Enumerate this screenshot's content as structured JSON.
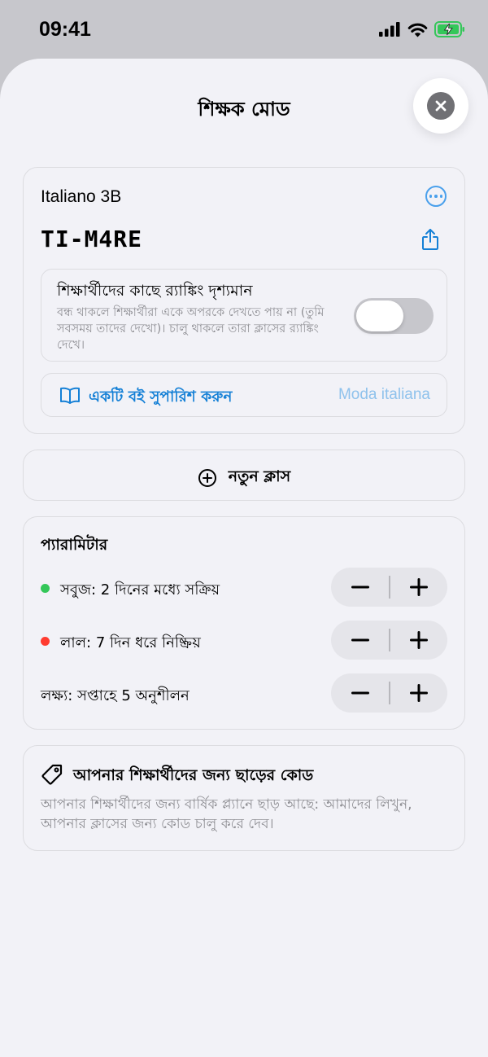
{
  "status_bar": {
    "time": "09:41"
  },
  "sheet": {
    "title": "শিক্ষক মোড"
  },
  "class_card": {
    "name": "Italiano 3B",
    "code": "TI-M4RE",
    "ranking": {
      "title": "শিক্ষার্থীদের কাছে র‍্যাঙ্কিং দৃশ্যমান",
      "description": "বন্ধ থাকলে শিক্ষার্থীরা একে অপরকে দেখতে পায় না (তুমি সবসময় তাদের দেখো)। চালু থাকলে তারা ক্লাসের র‍্যাঙ্কিং দেখে।",
      "enabled": false
    },
    "book": {
      "label": "একটি বই সুপারিশ করুন",
      "value": "Moda italiana"
    }
  },
  "new_class": {
    "label": "নতুন ক্লাস"
  },
  "params": {
    "title": "প্যারামিটার",
    "rows": [
      {
        "label": "সবুজ: 2 দিনের মধ্যে সক্রিয়",
        "dot_color": "#34c759"
      },
      {
        "label": "লাল: 7 দিন ধরে নিষ্ক্রিয়",
        "dot_color": "#ff3b30"
      },
      {
        "label": "লক্ষ্য: সপ্তাহে 5 অনুশীলন",
        "dot_color": ""
      }
    ]
  },
  "promo": {
    "title": "আপনার শিক্ষার্থীদের জন্য ছাড়ের কোড",
    "description": "আপনার শিক্ষার্থীদের জন্য বার্ষিক প্ল্যানে ছাড় আছে: আমাদের লিখুন, আপনার ক্লাসের জন্য কোড চালু করে দেব।"
  },
  "colors": {
    "accent": "#1580d6",
    "sheet_bg": "#f2f2f7",
    "green": "#34c759",
    "red": "#ff3b30",
    "battery": "#34c759"
  }
}
